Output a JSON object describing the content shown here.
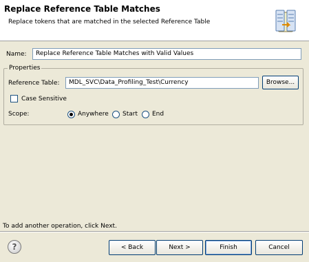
{
  "header": {
    "title": "Replace Reference Table Matches",
    "description": "Replace tokens that are matched in the selected Reference Table"
  },
  "name": {
    "label": "Name:",
    "value": "Replace Reference Table Matches with Valid Values"
  },
  "properties": {
    "legend": "Properties",
    "reference_table_label": "Reference Table:",
    "reference_table_value": "MDL_SVC\\Data_Profiling_Test\\Currency",
    "browse_label": "Browse...",
    "case_sensitive_label": "Case Sensitive",
    "case_sensitive_checked": false,
    "scope_label": "Scope:",
    "scope_options": [
      "Anywhere",
      "Start",
      "End"
    ],
    "scope_selected": "Anywhere"
  },
  "footer_message": "To add another operation, click Next.",
  "buttons": {
    "help": "?",
    "back": "< Back",
    "next": "Next >",
    "finish": "Finish",
    "cancel": "Cancel"
  },
  "colors": {
    "dialog_bg": "#ece9d8",
    "header_bg": "#ffffff",
    "button_border": "#003c74"
  }
}
